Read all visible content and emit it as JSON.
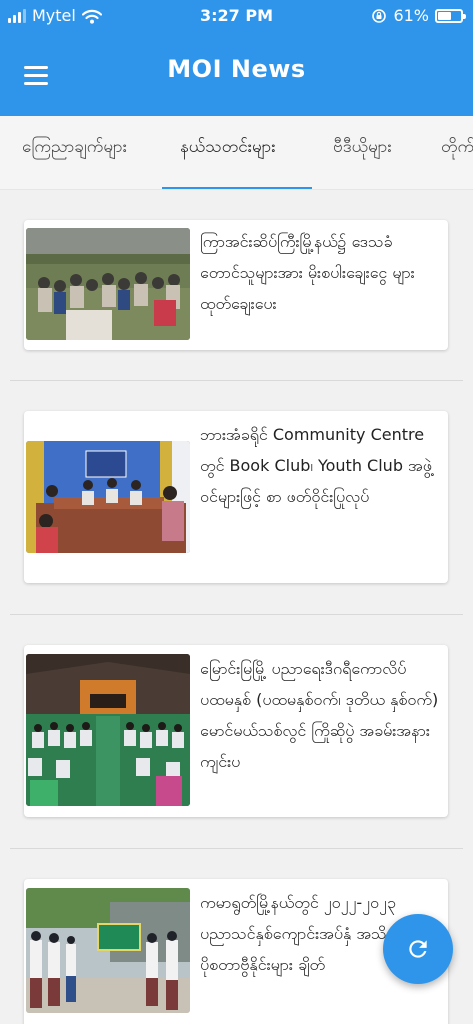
{
  "status_bar": {
    "carrier": "Mytel",
    "time": "3:27 PM",
    "battery_percent": "61%",
    "battery_level": 0.61,
    "icons": [
      "signal-icon",
      "wifi-icon",
      "rotation-lock-icon",
      "battery-icon"
    ]
  },
  "header": {
    "title": "MOI News",
    "menu_icon": "hamburger-menu-icon"
  },
  "tabs": [
    {
      "label": "ကြေညာချက်များ"
    },
    {
      "label": "နယ်သတင်းများ"
    },
    {
      "label": "ဗီဒီယိုများ"
    },
    {
      "label": "တိုက်"
    }
  ],
  "active_tab": 1,
  "news": [
    {
      "title": "ကြာအင်းဆိပ်ကြီးမြို့နယ်၌ ဒေသခံ တောင်သူများအား မိုးစပါးချေးငွေ များ ထုတ်ချေးပေး"
    },
    {
      "title": "ဘားအံခရိုင် Community Centre တွင် Book Club၊ Youth Club အဖွဲ့ဝင်များဖြင့် စာ ဖတ်ဝိုင်းပြုလုပ်"
    },
    {
      "title": "မြောင်းမြမြို့ ပညာရေးဒီဂရီကောလိပ် ပထမနှစ် (ပထမနှစ်ဝက်၊ ဒုတိယ နှစ်ဝက်) မောင်မယ်သစ်လွင် ကြိုဆိုပွဲ အခမ်းအနားကျင်းပ"
    },
    {
      "title": "ကမာရွတ်မြို့နယ်တွင် ၂၀၂၂-၂၀၂၃ ပညာသင်နှစ်ကျောင်းအပ်နှံ အသိပေးပိုစတာဗွီနိုင်းများ ချိတ်"
    }
  ],
  "fab": {
    "icon": "refresh-icon"
  },
  "colors": {
    "primary": "#2f95ea",
    "background": "#f1f1f1",
    "card": "#ffffff"
  }
}
